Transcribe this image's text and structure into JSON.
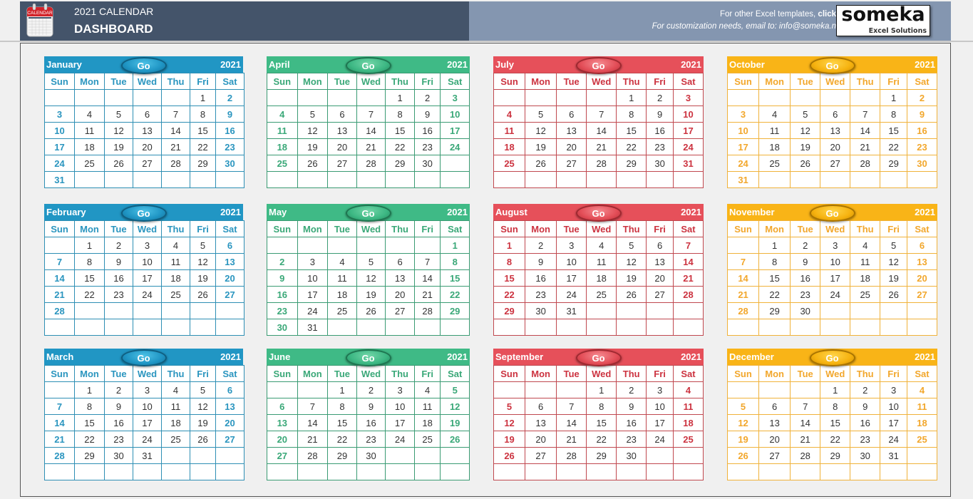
{
  "header": {
    "title_line1": "2021 CALENDAR",
    "title_line2": "DASHBOARD",
    "icon_label": "CALENDAR",
    "promo_line1_prefix": "For other Excel templates, ",
    "promo_line1_link": "click",
    "promo_line2": "For customization needs, email to: info@someka.n",
    "logo_main": "someka",
    "logo_sub": "Excel Solutions"
  },
  "colors": {
    "header_left": "#44546a",
    "header_right": "#8496b0",
    "blue": "#2196c4",
    "green": "#3fba86",
    "red": "#e6505a",
    "orange": "#f9b417"
  },
  "weekdays": [
    "Sun",
    "Mon",
    "Tue",
    "Wed",
    "Thu",
    "Fri",
    "Sat"
  ],
  "go_label": "Go",
  "year": "2021",
  "months": [
    {
      "name": "January",
      "theme": "blue",
      "start": 5,
      "days": 31
    },
    {
      "name": "February",
      "theme": "blue",
      "start": 1,
      "days": 28
    },
    {
      "name": "March",
      "theme": "blue",
      "start": 1,
      "days": 31
    },
    {
      "name": "April",
      "theme": "green",
      "start": 4,
      "days": 30
    },
    {
      "name": "May",
      "theme": "green",
      "start": 6,
      "days": 31
    },
    {
      "name": "June",
      "theme": "green",
      "start": 2,
      "days": 30
    },
    {
      "name": "July",
      "theme": "red",
      "start": 4,
      "days": 31
    },
    {
      "name": "August",
      "theme": "red",
      "start": 0,
      "days": 31
    },
    {
      "name": "September",
      "theme": "red",
      "start": 3,
      "days": 30
    },
    {
      "name": "October",
      "theme": "orange",
      "start": 5,
      "days": 31
    },
    {
      "name": "November",
      "theme": "orange",
      "start": 1,
      "days": 30
    },
    {
      "name": "December",
      "theme": "orange",
      "start": 3,
      "days": 31
    }
  ]
}
